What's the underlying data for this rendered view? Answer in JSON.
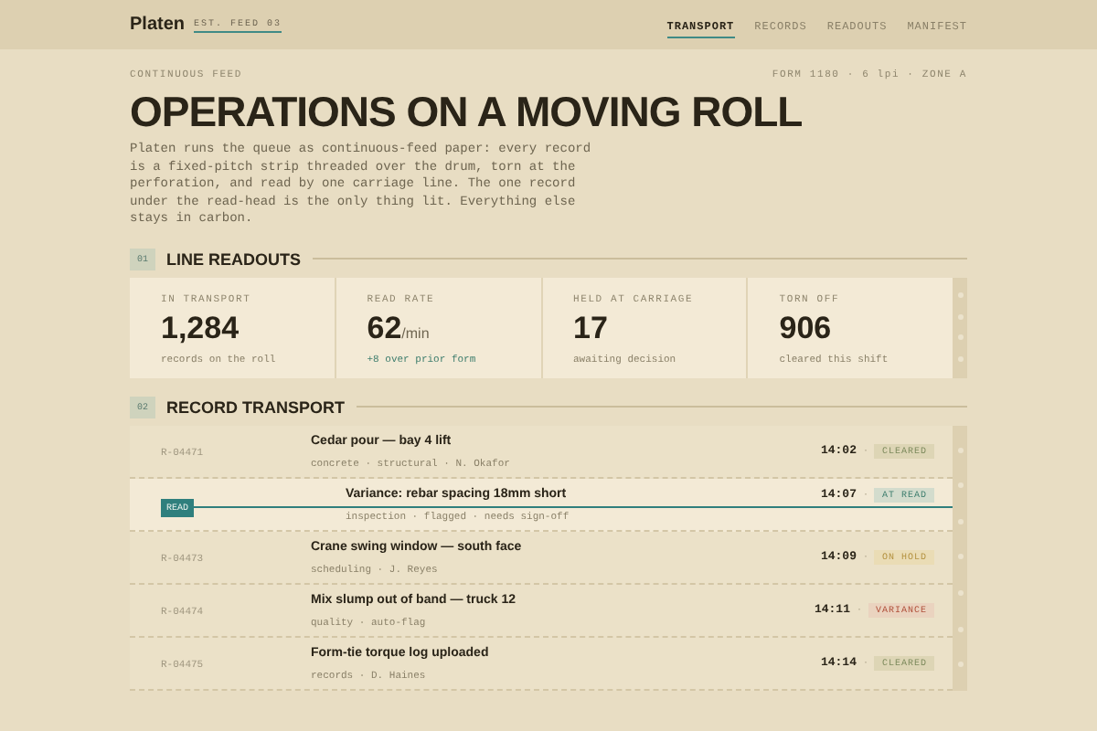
{
  "brand": {
    "name": "Platen",
    "tag": "EST. FEED 03"
  },
  "nav": [
    {
      "label": "TRANSPORT",
      "selected": true
    },
    {
      "label": "RECORDS",
      "selected": false
    },
    {
      "label": "READOUTS",
      "selected": false
    },
    {
      "label": "MANIFEST",
      "selected": false
    }
  ],
  "hero": {
    "eyebrow": "CONTINUOUS FEED",
    "form": "FORM 1180 · 6 lpi · ZONE A",
    "title": "OPERATIONS ON A MOVING ROLL",
    "intro": "Platen runs the queue as continuous-feed paper: every record is a fixed-pitch strip threaded over the drum, torn at the perforation, and read by one carriage line. The one record under the read-head is the only thing lit. Everything else stays in carbon."
  },
  "readouts": {
    "number": "01",
    "title": "LINE READOUTS",
    "cards": [
      {
        "label": "IN TRANSPORT",
        "value": "1,284",
        "note": "records on the roll",
        "positive": false
      },
      {
        "label": "READ RATE",
        "value": "62",
        "unit": "/min",
        "note": "+8 over prior form",
        "positive": true
      },
      {
        "label": "HELD AT CARRIAGE",
        "value": "17",
        "note": "awaiting decision",
        "positive": false
      },
      {
        "label": "TORN OFF",
        "value": "906",
        "note": "cleared this shift",
        "positive": false
      }
    ]
  },
  "transport": {
    "number": "02",
    "title": "RECORD TRANSPORT",
    "read_label": "READ",
    "rows": [
      {
        "id": "R-04471",
        "title": "Cedar pour — bay 4 lift",
        "meta": "concrete · structural · N. Okafor",
        "time": "14:02",
        "separator": "·",
        "status": "CLEARED",
        "kind": "cleared",
        "selected": false
      },
      {
        "title": "Variance: rebar spacing 18mm short",
        "meta": "inspection · flagged · needs sign-off",
        "time": "14:07",
        "separator": "·",
        "status": "AT READ",
        "kind": "read",
        "selected": true
      },
      {
        "id": "R-04473",
        "title": "Crane swing window — south face",
        "meta": "scheduling · J. Reyes",
        "time": "14:09",
        "separator": "·",
        "status": "ON HOLD",
        "kind": "hold",
        "selected": false
      },
      {
        "id": "R-04474",
        "title": "Mix slump out of band — truck 12",
        "meta": "quality · auto-flag",
        "time": "14:11",
        "separator": "·",
        "status": "VARIANCE",
        "kind": "variance",
        "selected": false
      },
      {
        "id": "R-04475",
        "title": "Form-tie torque log uploaded",
        "meta": "records · D. Haines",
        "time": "14:14",
        "separator": "·",
        "status": "CLEARED",
        "kind": "cleared",
        "selected": false
      }
    ]
  }
}
